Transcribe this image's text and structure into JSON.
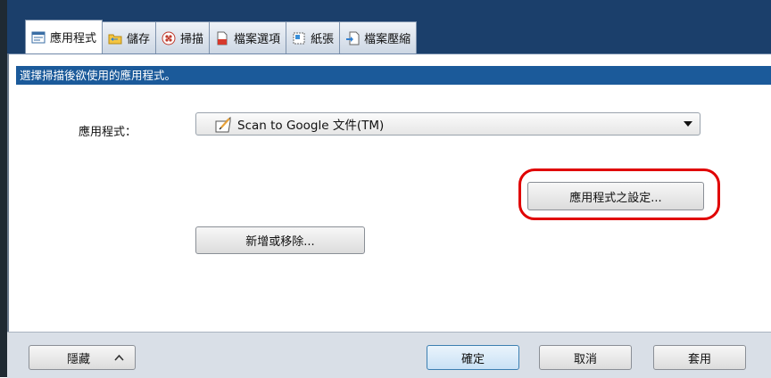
{
  "tabs": [
    {
      "label": "應用程式",
      "icon": "application-icon",
      "active": true
    },
    {
      "label": "儲存",
      "icon": "folder-icon",
      "active": false
    },
    {
      "label": "掃描",
      "icon": "scan-icon",
      "active": false
    },
    {
      "label": "檔案選項",
      "icon": "file-options-icon",
      "active": false
    },
    {
      "label": "紙張",
      "icon": "paper-icon",
      "active": false
    },
    {
      "label": "檔案壓縮",
      "icon": "compression-icon",
      "active": false
    }
  ],
  "description": "選擇掃描後欲使用的應用程式。",
  "application": {
    "label": "應用程式：",
    "selected": "Scan to Google 文件(TM)",
    "icon": "google-docs-icon"
  },
  "buttons": {
    "app_settings": "應用程式之設定...",
    "add_remove": "新增或移除...",
    "hide": "隱藏",
    "ok": "確定",
    "cancel": "取消",
    "apply": "套用"
  },
  "colors": {
    "header": "#1b3f6b",
    "description_bar": "#1b5a9a",
    "highlight": "#e00000"
  }
}
